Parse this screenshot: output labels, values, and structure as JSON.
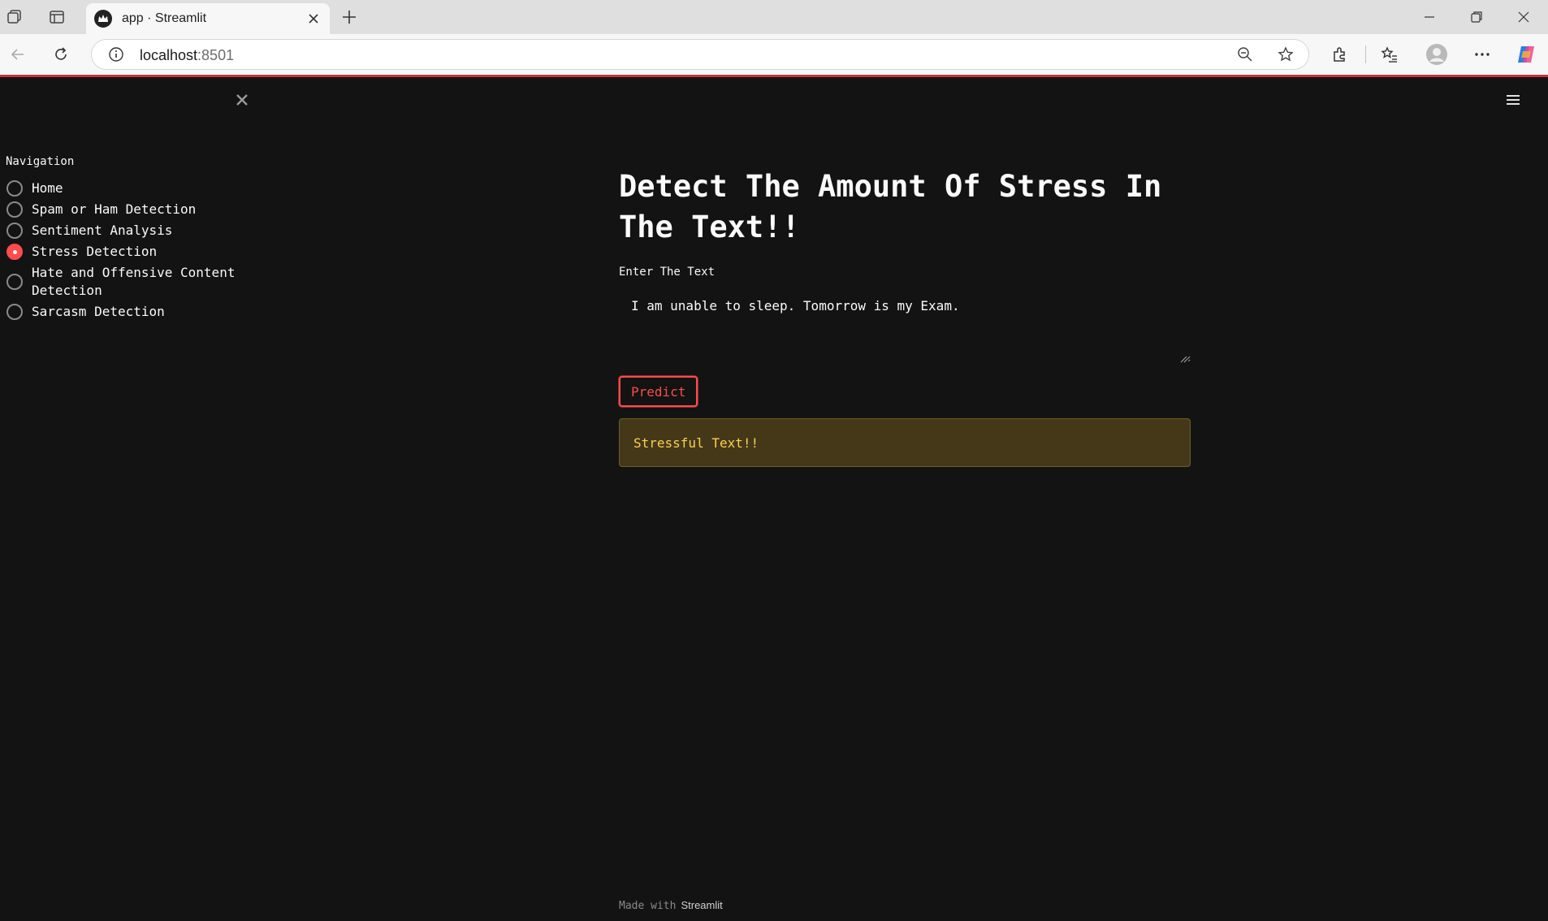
{
  "browser": {
    "tab_title": "app · Streamlit",
    "url_host": "localhost",
    "url_port": ":8501"
  },
  "sidebar": {
    "nav_label": "Navigation",
    "items": [
      {
        "label": "Home",
        "selected": false
      },
      {
        "label": "Spam or Ham Detection",
        "selected": false
      },
      {
        "label": "Sentiment Analysis",
        "selected": false
      },
      {
        "label": "Stress Detection",
        "selected": true
      },
      {
        "label": "Hate and Offensive Content Detection",
        "selected": false
      },
      {
        "label": "Sarcasm Detection",
        "selected": false
      }
    ]
  },
  "main": {
    "title": "Detect The Amount Of Stress In The Text!!",
    "input_label": "Enter The Text",
    "input_value": "I am unable to sleep. Tomorrow is my Exam.",
    "button_label": "Predict",
    "result_text": "Stressful Text!!"
  },
  "footer": {
    "made_with": "Made with",
    "brand": "Streamlit"
  },
  "colors": {
    "accent": "#ff4b4b",
    "background": "#131313",
    "warning_bg": "#443819",
    "warning_text": "#ffd04b"
  }
}
